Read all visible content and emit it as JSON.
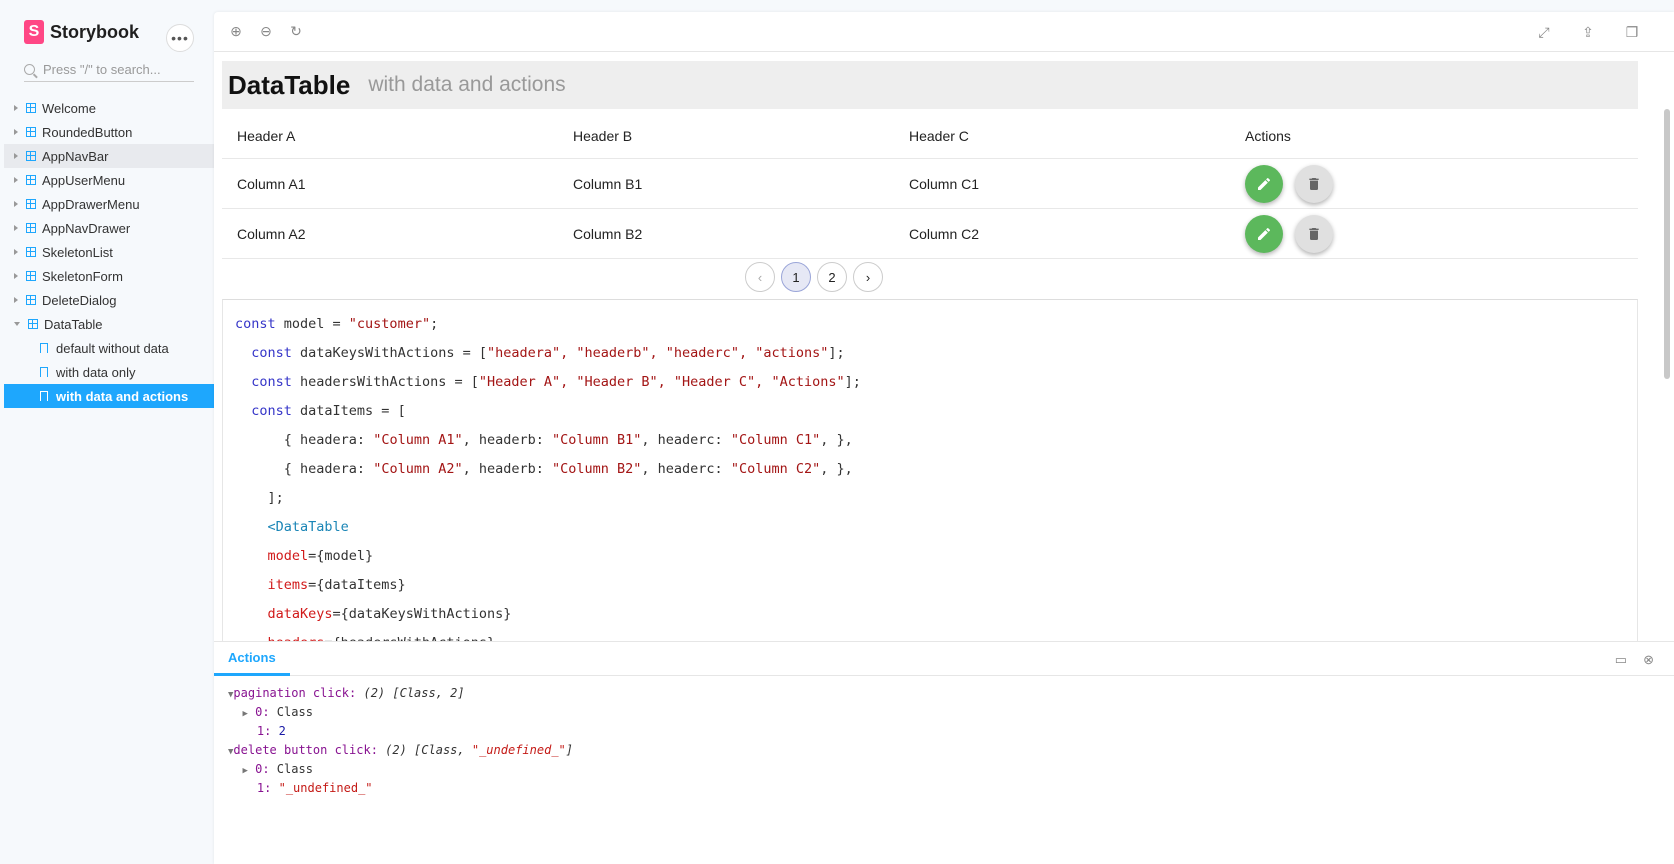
{
  "sidebar": {
    "brand": "Storybook",
    "search_placeholder": "Press \"/\" to search...",
    "items": [
      "Welcome",
      "RoundedButton",
      "AppNavBar",
      "AppUserMenu",
      "AppDrawerMenu",
      "AppNavDrawer",
      "SkeletonList",
      "SkeletonForm",
      "DeleteDialog",
      "DataTable"
    ],
    "stories": [
      "default without data",
      "with data only",
      "with data and actions"
    ]
  },
  "canvas": {
    "title": "DataTable",
    "subtitle": "with data and actions",
    "headers": [
      "Header A",
      "Header B",
      "Header C",
      "Actions"
    ],
    "rows": [
      [
        "Column A1",
        "Column B1",
        "Column C1"
      ],
      [
        "Column A2",
        "Column B2",
        "Column C2"
      ]
    ],
    "pages": [
      "1",
      "2"
    ]
  },
  "code": {
    "l1a": "const",
    "l1b": " model = ",
    "l1c": "\"customer\"",
    "l1d": ";",
    "l2a": "const",
    "l2b": " dataKeysWithActions = [",
    "l2c": "\"headera\", \"headerb\", \"headerc\", \"actions\"",
    "l2d": "];",
    "l3a": "const",
    "l3b": " headersWithActions = [",
    "l3c": "\"Header A\", \"Header B\", \"Header C\", \"Actions\"",
    "l3d": "];",
    "l4a": "const",
    "l4b": " dataItems = [",
    "l5a": "{ headera: ",
    "l5b": "\"Column A1\"",
    "l5c": ", headerb: ",
    "l5d": "\"Column B1\"",
    "l5e": ", headerc: ",
    "l5f": "\"Column C1\"",
    "l5g": ", },",
    "l6a": "{ headera: ",
    "l6b": "\"Column A2\"",
    "l6c": ", headerb: ",
    "l6d": "\"Column B2\"",
    "l6e": ", headerc: ",
    "l6f": "\"Column C2\"",
    "l6g": ", },",
    "l7": "];",
    "l8": "<DataTable",
    "l9a": "model",
    "l9b": "={model}",
    "l10a": "items",
    "l10b": "={dataItems}",
    "l11a": "dataKeys",
    "l11b": "={dataKeysWithActions}",
    "l12a": "headers",
    "l12b": "={headersWithActions}"
  },
  "panel": {
    "tab": "Actions",
    "log": {
      "e1": "pagination click:",
      "e1v": "(2) [Class, 2]",
      "e1c0": "0:",
      "e1c0v": "Class",
      "e1c1": "1:",
      "e1c1v": "2",
      "e2": "delete button click:",
      "e2v": "(2) [Class, ",
      "e2s": "\"_undefined_\"",
      "e2e": "]",
      "e2c0": "0:",
      "e2c0v": "Class",
      "e2c1": "1:",
      "e2c1v": "\"_undefined_\""
    }
  }
}
